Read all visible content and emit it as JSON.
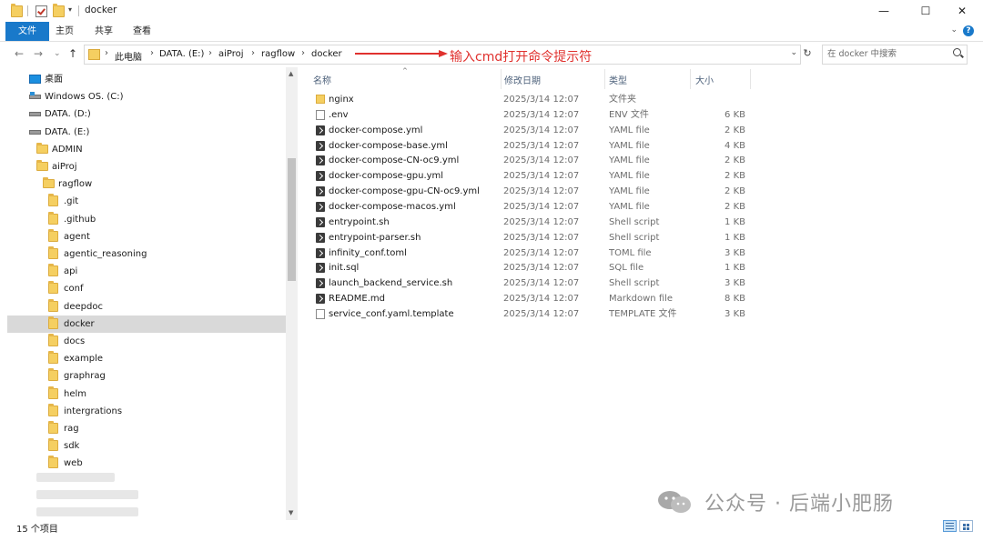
{
  "window": {
    "title": "docker",
    "minimize": "—",
    "maximize": "☐",
    "close": "✕"
  },
  "ribbon": {
    "tabs": [
      "文件",
      "主页",
      "共享",
      "查看"
    ],
    "expand_glyph": "⌄",
    "help_glyph": "?"
  },
  "address": {
    "crumbs": [
      "此电脑",
      "DATA. (E:)",
      "aiProj",
      "ragflow",
      "docker"
    ],
    "separator": "›",
    "dropdown_glyph": "⌄",
    "refresh_glyph": "↻"
  },
  "search": {
    "placeholder": "在 docker 中搜索"
  },
  "nav_buttons": {
    "back": "←",
    "forward": "→",
    "recent": "⌄",
    "up": "↑"
  },
  "annotation": {
    "text": "输入cmd打开命令提示符",
    "color": "#e0312e"
  },
  "tree": [
    {
      "label": "桌面",
      "icon": "desktop-icon"
    },
    {
      "label": "Windows OS. (C:)",
      "icon": "windows-drive-icon"
    },
    {
      "label": "DATA. (D:)",
      "icon": "drive-icon"
    },
    {
      "label": "DATA. (E:)",
      "icon": "drive-icon"
    },
    {
      "label": "ADMIN",
      "icon": "folder-icon"
    },
    {
      "label": "aiProj",
      "icon": "folder-icon"
    },
    {
      "label": "ragflow",
      "icon": "folder-icon"
    },
    {
      "label": ".git",
      "icon": "folder-icon"
    },
    {
      "label": ".github",
      "icon": "folder-icon"
    },
    {
      "label": "agent",
      "icon": "folder-icon"
    },
    {
      "label": "agentic_reasoning",
      "icon": "folder-icon"
    },
    {
      "label": "api",
      "icon": "folder-icon"
    },
    {
      "label": "conf",
      "icon": "folder-icon"
    },
    {
      "label": "deepdoc",
      "icon": "folder-icon"
    },
    {
      "label": "docker",
      "icon": "folder-icon",
      "selected": true
    },
    {
      "label": "docs",
      "icon": "folder-icon"
    },
    {
      "label": "example",
      "icon": "folder-icon"
    },
    {
      "label": "graphrag",
      "icon": "folder-icon"
    },
    {
      "label": "helm",
      "icon": "folder-icon"
    },
    {
      "label": "intergrations",
      "icon": "folder-icon"
    },
    {
      "label": "rag",
      "icon": "folder-icon"
    },
    {
      "label": "sdk",
      "icon": "folder-icon"
    },
    {
      "label": "web",
      "icon": "folder-icon"
    }
  ],
  "columns": {
    "name": "名称",
    "date": "修改日期",
    "type": "类型",
    "size": "大小",
    "sort_glyph": "^"
  },
  "files": [
    {
      "name": "nginx",
      "date": "2025/3/14 12:07",
      "type": "文件夹",
      "size": "",
      "icon": "folder-icon"
    },
    {
      "name": ".env",
      "date": "2025/3/14 12:07",
      "type": "ENV 文件",
      "size": "6 KB",
      "icon": "file-icon"
    },
    {
      "name": "docker-compose.yml",
      "date": "2025/3/14 12:07",
      "type": "YAML file",
      "size": "2 KB",
      "icon": "script-file-icon"
    },
    {
      "name": "docker-compose-base.yml",
      "date": "2025/3/14 12:07",
      "type": "YAML file",
      "size": "4 KB",
      "icon": "script-file-icon"
    },
    {
      "name": "docker-compose-CN-oc9.yml",
      "date": "2025/3/14 12:07",
      "type": "YAML file",
      "size": "2 KB",
      "icon": "script-file-icon"
    },
    {
      "name": "docker-compose-gpu.yml",
      "date": "2025/3/14 12:07",
      "type": "YAML file",
      "size": "2 KB",
      "icon": "script-file-icon"
    },
    {
      "name": "docker-compose-gpu-CN-oc9.yml",
      "date": "2025/3/14 12:07",
      "type": "YAML file",
      "size": "2 KB",
      "icon": "script-file-icon"
    },
    {
      "name": "docker-compose-macos.yml",
      "date": "2025/3/14 12:07",
      "type": "YAML file",
      "size": "2 KB",
      "icon": "script-file-icon"
    },
    {
      "name": "entrypoint.sh",
      "date": "2025/3/14 12:07",
      "type": "Shell script",
      "size": "1 KB",
      "icon": "script-file-icon"
    },
    {
      "name": "entrypoint-parser.sh",
      "date": "2025/3/14 12:07",
      "type": "Shell script",
      "size": "1 KB",
      "icon": "script-file-icon"
    },
    {
      "name": "infinity_conf.toml",
      "date": "2025/3/14 12:07",
      "type": "TOML file",
      "size": "3 KB",
      "icon": "script-file-icon"
    },
    {
      "name": "init.sql",
      "date": "2025/3/14 12:07",
      "type": "SQL file",
      "size": "1 KB",
      "icon": "script-file-icon"
    },
    {
      "name": "launch_backend_service.sh",
      "date": "2025/3/14 12:07",
      "type": "Shell script",
      "size": "3 KB",
      "icon": "script-file-icon"
    },
    {
      "name": "README.md",
      "date": "2025/3/14 12:07",
      "type": "Markdown file",
      "size": "8 KB",
      "icon": "script-file-icon"
    },
    {
      "name": "service_conf.yaml.template",
      "date": "2025/3/14 12:07",
      "type": "TEMPLATE 文件",
      "size": "3 KB",
      "icon": "file-icon"
    }
  ],
  "status": {
    "count": "15 个项目"
  },
  "watermark": {
    "text": "公众号 · 后端小肥肠"
  }
}
